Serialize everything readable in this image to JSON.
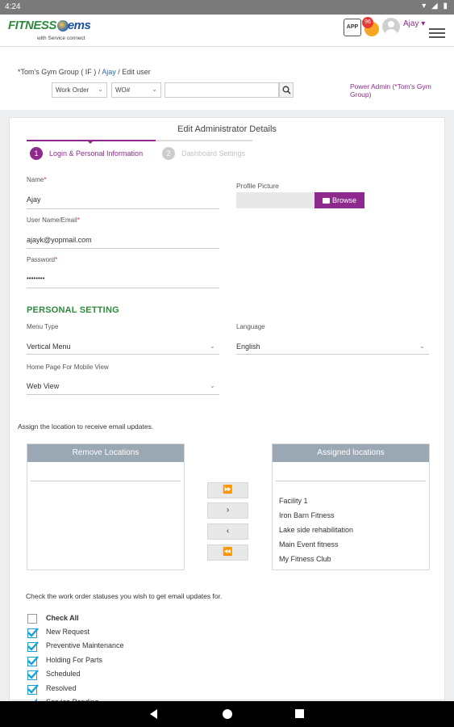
{
  "status_bar": {
    "time": "4:24",
    "icons": "▾ ◢ ▮"
  },
  "header": {
    "logo_fitness": "FITNESS",
    "logo_ems": "ems",
    "logo_tagline": "with Service connect",
    "app_icon_label": "APP",
    "notification_count": "96",
    "user_name": "Ajay ▾"
  },
  "breadcrumb": {
    "group": "*Tom's Gym Group ( IF ) /",
    "user_link": "Ajay",
    "current": "/ Edit user"
  },
  "search": {
    "type_select": "Work Order",
    "field_select": "WO#",
    "placeholder": ""
  },
  "power_admin": "Power Admin (*Tom's Gym Group)",
  "form": {
    "title": "Edit Administrator Details",
    "steps": [
      {
        "num": "1",
        "label": "Login & Personal Information",
        "active": true
      },
      {
        "num": "2",
        "label": "Dashboard Settings",
        "active": false
      }
    ],
    "name_label": "Name",
    "name_value": "Ajay",
    "email_label": "User Name/Email",
    "email_value": "ajayk@yopmail.com",
    "password_label": "Password",
    "password_value": "••••••••",
    "profile_label": "Profile Picture",
    "browse_label": "Browse",
    "personal_setting": "PERSONAL SETTING",
    "menu_type_label": "Menu Type",
    "menu_type_value": "Vertical Menu",
    "language_label": "Language",
    "language_value": "English",
    "home_page_label": "Home Page For Mobile View",
    "home_page_value": "Web View",
    "assign_text": "Assign the location to receive email updates.",
    "remove_locations_title": "Remove Locations",
    "assigned_locations_title": "Assigned locations",
    "assigned_locations": [
      "Facility 1",
      "Iron Barn Fitness",
      "Lake side rehabilitation",
      "Main Event fitness",
      "My Fitness Club"
    ],
    "move_buttons": [
      "⏩",
      "›",
      "‹",
      "⏪"
    ],
    "wo_text": "Check the work order statuses you wish to get email updates for.",
    "check_all": "Check All",
    "statuses": [
      "New Request",
      "Preventive Maintenance",
      "Holding For Parts",
      "Scheduled",
      "Resolved",
      "Service Pending"
    ]
  },
  "colors": {
    "brand_purple": "#8e2a8e",
    "brand_green": "#2e8b3e",
    "check_blue": "#1aa0d8",
    "panel_header": "#9aa8b4"
  }
}
